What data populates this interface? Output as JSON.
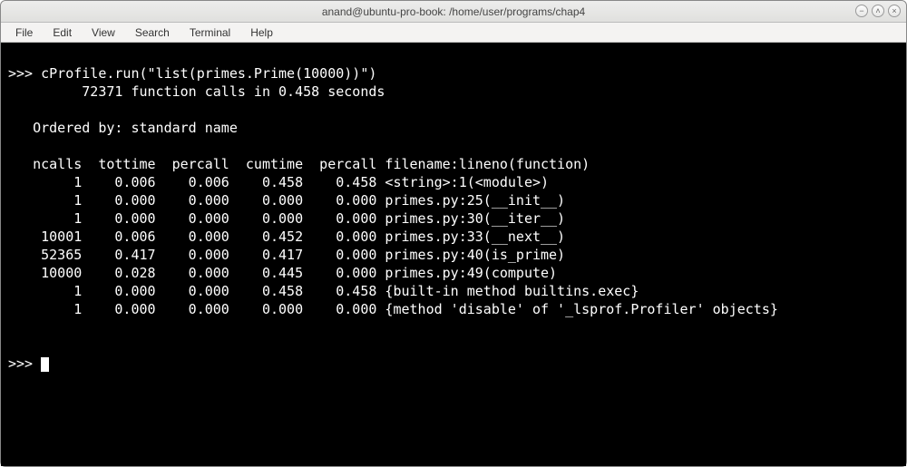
{
  "window": {
    "title": "anand@ubuntu-pro-book: /home/user/programs/chap4"
  },
  "menubar": {
    "items": [
      "File",
      "Edit",
      "View",
      "Search",
      "Terminal",
      "Help"
    ]
  },
  "terminal": {
    "prompt": ">>> ",
    "command": "cProfile.run(\"list(primes.Prime(10000))\")",
    "summary": "         72371 function calls in 0.458 seconds",
    "ordered_by": "   Ordered by: standard name",
    "header": "   ncalls  tottime  percall  cumtime  percall filename:lineno(function)",
    "rows": [
      "        1    0.006    0.006    0.458    0.458 <string>:1(<module>)",
      "        1    0.000    0.000    0.000    0.000 primes.py:25(__init__)",
      "        1    0.000    0.000    0.000    0.000 primes.py:30(__iter__)",
      "    10001    0.006    0.000    0.452    0.000 primes.py:33(__next__)",
      "    52365    0.417    0.000    0.417    0.000 primes.py:40(is_prime)",
      "    10000    0.028    0.000    0.445    0.000 primes.py:49(compute)",
      "        1    0.000    0.000    0.458    0.458 {built-in method builtins.exec}",
      "        1    0.000    0.000    0.000    0.000 {method 'disable' of '_lsprof.Profiler' objects}"
    ],
    "prompt2": ">>> "
  },
  "win_controls": {
    "minimize": "−",
    "maximize": "˄",
    "close": "×"
  }
}
